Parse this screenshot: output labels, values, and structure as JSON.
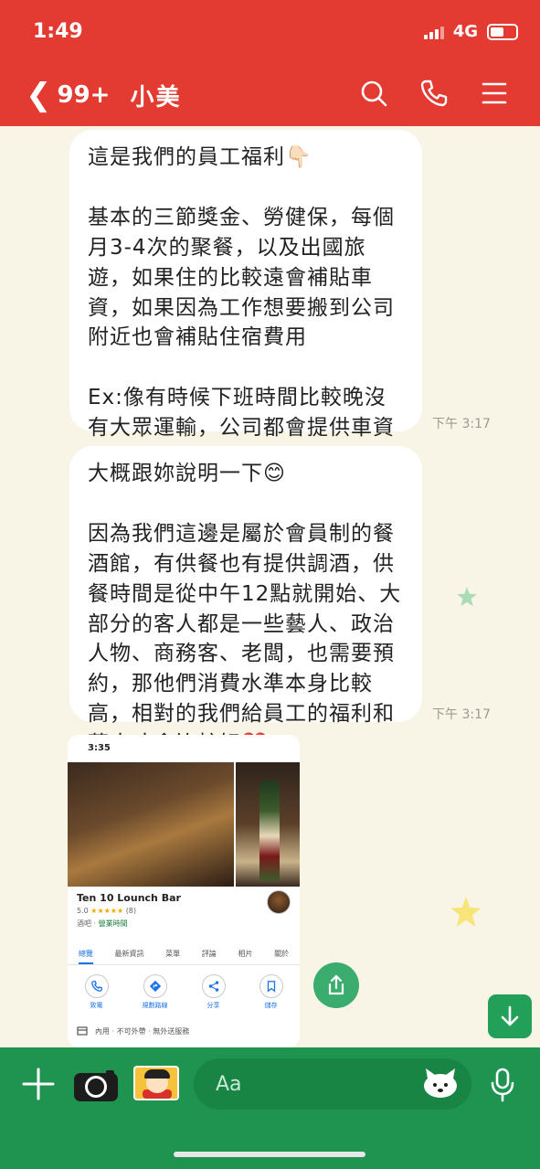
{
  "status_bar": {
    "time": "1:49",
    "network": "4G"
  },
  "header": {
    "back_count": "99+",
    "chat_name": "小美",
    "icons": [
      "search-icon",
      "phone-icon",
      "menu-icon"
    ]
  },
  "messages": [
    {
      "paragraphs": [
        "這是我們的員工福利👇🏻",
        "基本的三節獎金、勞健保，每個月3-4次的聚餐，以及出國旅遊，如果住的比較遠會補貼車資，如果因為工作想要搬到公司附近也會補貼住宿費用",
        "Ex:像有時候下班時間比較晚沒有大眾運輸，公司都會提供車資這一塊☺️"
      ],
      "time": "下午 3:17"
    },
    {
      "paragraphs": [
        "大概跟妳說明一下😊",
        "因為我們這邊是屬於會員制的餐酒館，有供餐也有提供調酒，供餐時間是從中午12點就開始、大部分的客人都是一些藝人、政治人物、商務客、老闆，也需要預約，那他們消費水準本身比較高，相對的我們給員工的福利和薪水才會比較好❤️"
      ],
      "time": "下午 3:17"
    }
  ],
  "shared_image": {
    "status_time": "3:35",
    "business_name": "Ten 10 Lounch Bar",
    "rating": "5.0",
    "stars": "★★★★★",
    "review_count": "(8)",
    "category": "酒吧",
    "hours_label": "營業時間",
    "tabs": [
      "總覽",
      "最新資訊",
      "菜單",
      "評論",
      "相片",
      "關於"
    ],
    "actions": [
      "致電",
      "規劃路線",
      "分享",
      "儲存"
    ],
    "services": "內用 · 不可外帶 · 無外送服務"
  },
  "composer": {
    "placeholder": "Aa"
  },
  "colors": {
    "header": "#e33a32",
    "bottom_bar": "#1f9450",
    "background": "#f8f5e6"
  }
}
